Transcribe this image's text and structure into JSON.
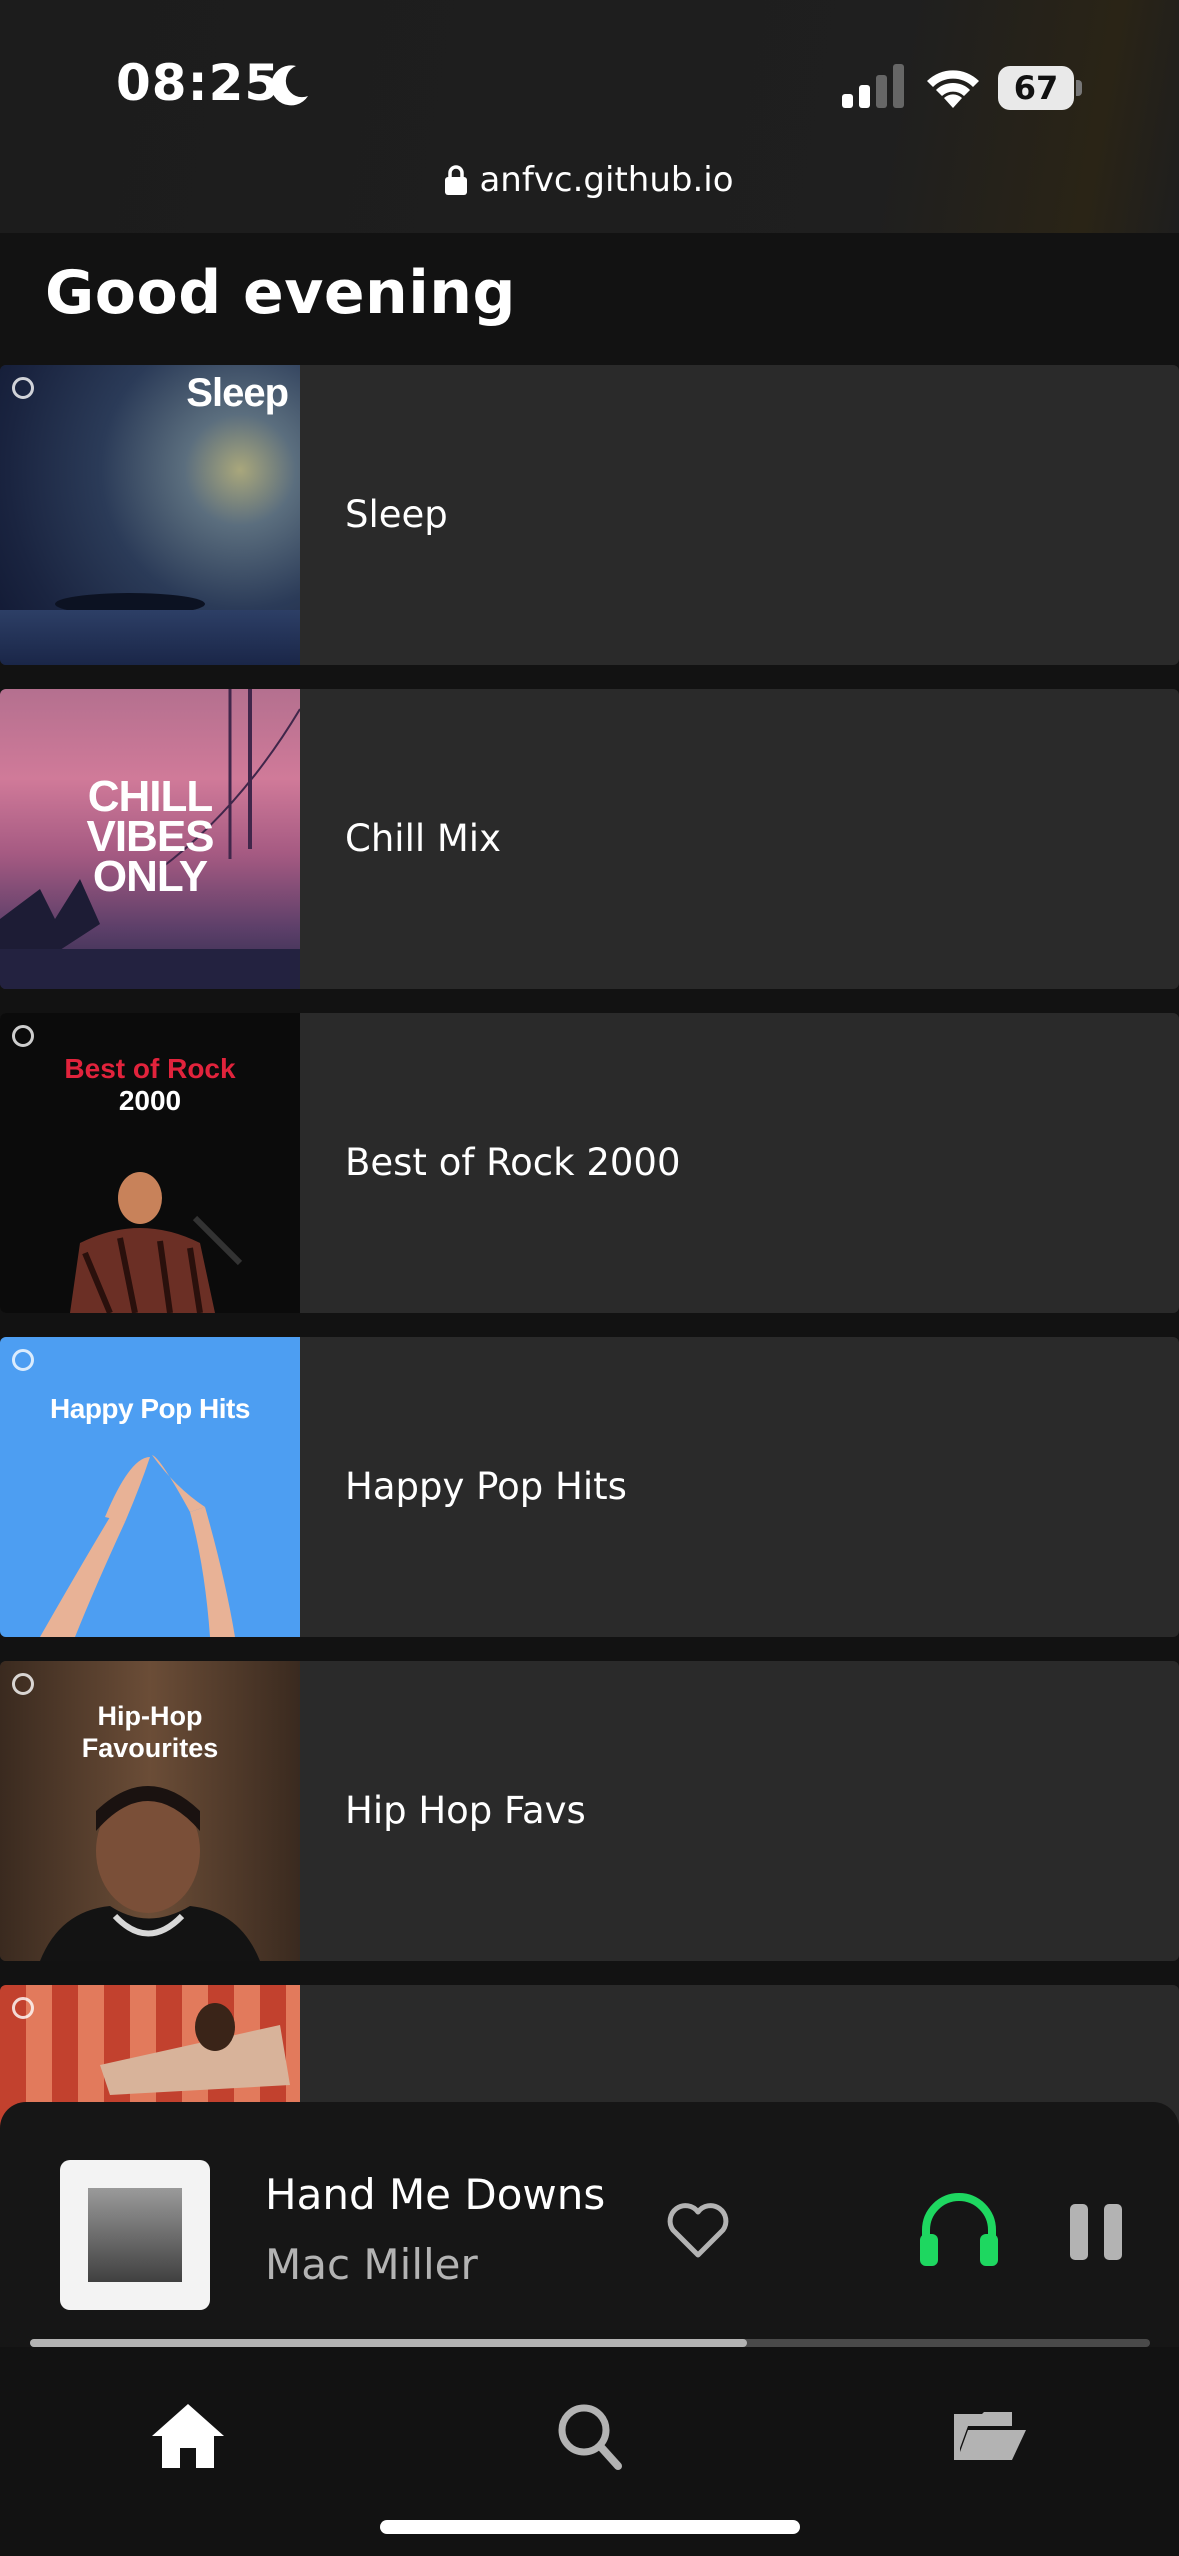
{
  "status_bar": {
    "time": "08:25",
    "battery": "67"
  },
  "browser": {
    "url": "anfvc.github.io"
  },
  "greeting": "Good evening",
  "playlists": [
    {
      "label": "Sleep",
      "cover_text": "Sleep"
    },
    {
      "label": "Chill Mix",
      "cover_text": "CHILL VIBES ONLY"
    },
    {
      "label": "Best of Rock 2000",
      "cover_text_line1": "Best of Rock",
      "cover_text_line2": "2000"
    },
    {
      "label": "Happy Pop Hits",
      "cover_text": "Happy Pop Hits"
    },
    {
      "label": "Hip Hop Favs",
      "cover_text_line1": "Hip-Hop",
      "cover_text_line2": "Favourites"
    },
    {
      "label": ""
    }
  ],
  "now_playing": {
    "title": "Hand Me Downs",
    "artist": "Mac Miller",
    "progress_fraction": 0.64
  },
  "colors": {
    "accent_green": "#1ed760",
    "row_bg": "#2a2a2a",
    "page_bg": "#121212"
  },
  "icons": {
    "nav": [
      "home-icon",
      "search-icon",
      "folder-icon"
    ],
    "player": [
      "heart-icon",
      "headphones-icon",
      "pause-icon"
    ]
  }
}
